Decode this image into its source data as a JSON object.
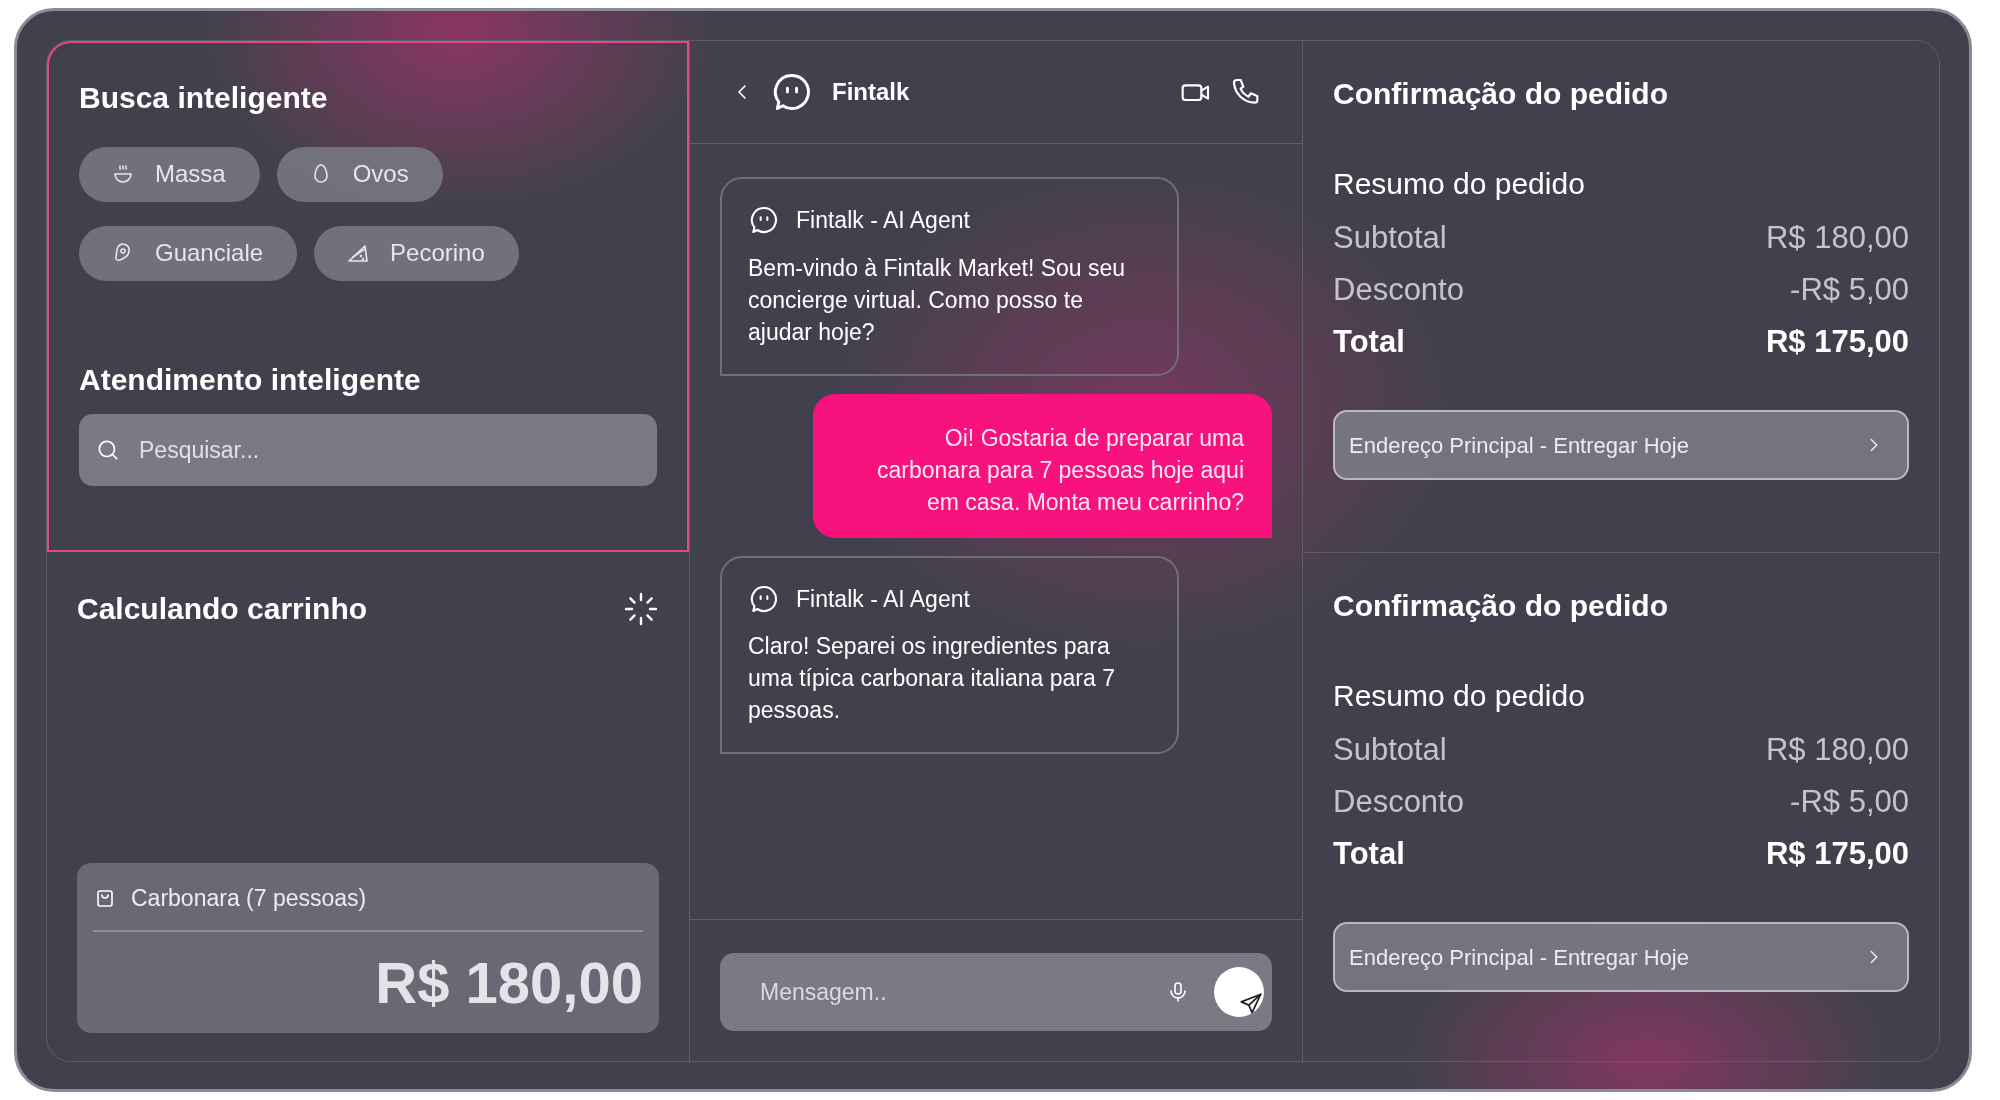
{
  "search_panel": {
    "title": "Busca inteligente",
    "chips": [
      {
        "label": "Massa",
        "kind": "bowl"
      },
      {
        "label": "Ovos",
        "kind": "egg"
      },
      {
        "label": "Guanciale",
        "kind": "meat"
      },
      {
        "label": "Pecorino",
        "kind": "cheese"
      }
    ],
    "support_title": "Atendimento inteligente",
    "search": {
      "placeholder": "Pesquisar..."
    }
  },
  "cart_panel": {
    "title": "Calculando carrinho",
    "item": "Carbonara (7 pessoas)",
    "price": "R$ 180,00"
  },
  "chat": {
    "title": "Fintalk",
    "messages": [
      {
        "kind": "agent",
        "sender": "Fintalk - AI Agent",
        "text": "Bem-vindo à Fintalk Market! Sou seu concierge virtual. Como posso te ajudar hoje?"
      },
      {
        "kind": "user",
        "text": "Oi! Gostaria de preparar uma carbonara para 7 pessoas hoje aqui em casa. Monta meu carrinho?"
      },
      {
        "kind": "agent",
        "sender": "Fintalk - AI Agent",
        "text": "Claro! Separei os ingredientes para uma típica carbonara italiana para 7 pessoas."
      }
    ],
    "composer": {
      "placeholder": "Mensagem.."
    }
  },
  "orders": [
    {
      "title": "Confirmação do pedido",
      "summary_title": "Resumo do pedido",
      "rows": [
        {
          "label": "Subtotal",
          "value": "R$ 180,00",
          "kind": "normal"
        },
        {
          "label": "Desconto",
          "value": "-R$ 5,00",
          "kind": "normal"
        },
        {
          "label": "Total",
          "value": "R$ 175,00",
          "kind": "total"
        }
      ],
      "address": "Endereço Principal - Entregar Hoje"
    },
    {
      "title": "Confirmação do pedido",
      "summary_title": "Resumo do pedido",
      "rows": [
        {
          "label": "Subtotal",
          "value": "R$ 180,00",
          "kind": "normal"
        },
        {
          "label": "Desconto",
          "value": "-R$ 5,00",
          "kind": "normal"
        },
        {
          "label": "Total",
          "value": "R$ 175,00",
          "kind": "total"
        }
      ],
      "address": "Endereço Principal - Entregar Hoje"
    }
  ]
}
